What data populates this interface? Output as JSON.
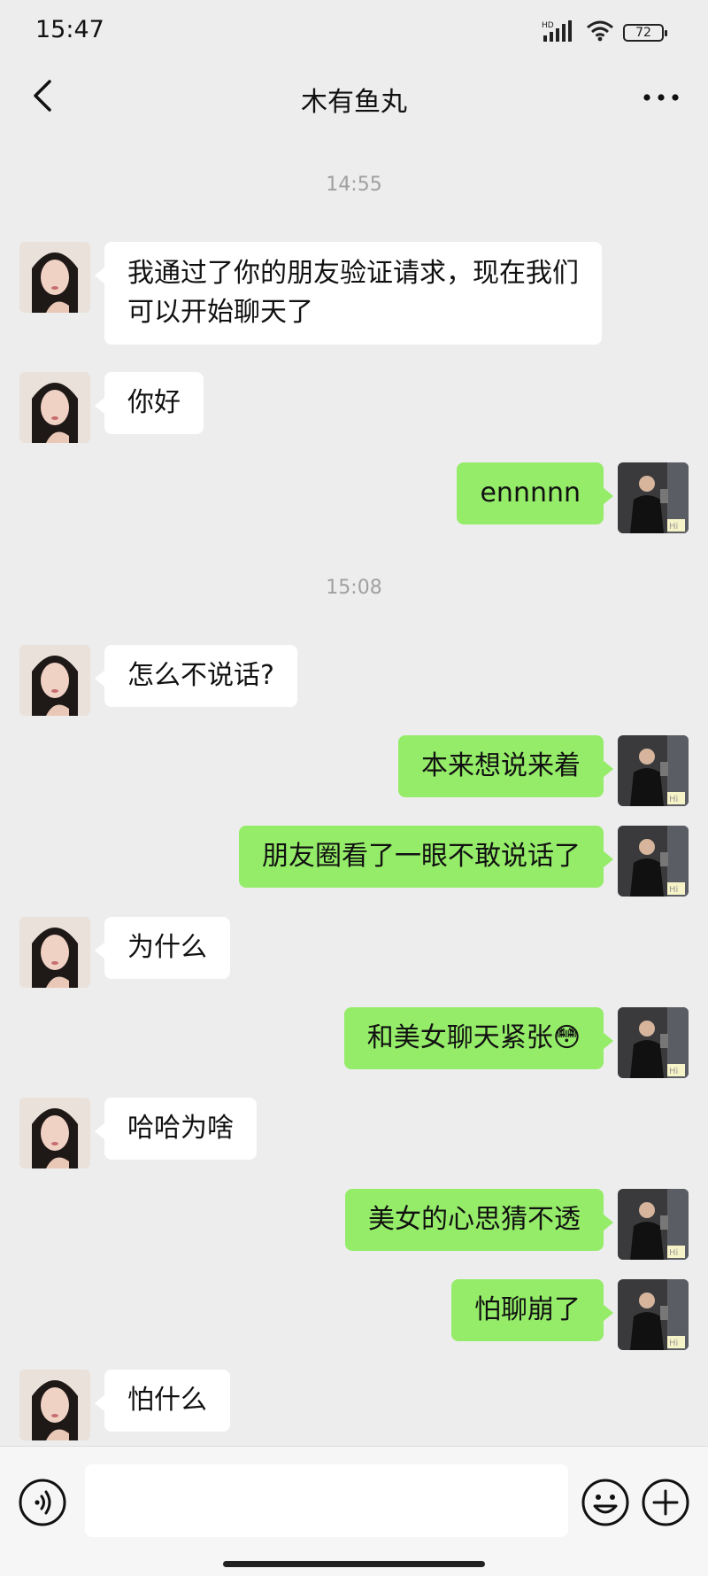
{
  "status_bar": {
    "time": "15:47",
    "network": "HD",
    "battery": "72",
    "icons": [
      "signal-icon",
      "wifi-icon",
      "battery-icon"
    ]
  },
  "header": {
    "title": "木有鱼丸",
    "back_icon": "chevron-left-icon",
    "more_icon": "more-dots-icon"
  },
  "timestamps": [
    "14:55",
    "15:08"
  ],
  "messages": [
    {
      "side": "in",
      "text": "我通过了你的朋友验证请求，现在我们可以开始聊天了"
    },
    {
      "side": "in",
      "text": "你好"
    },
    {
      "side": "out",
      "text": "ennnnn"
    },
    {
      "side": "in",
      "text": "怎么不说话?"
    },
    {
      "side": "out",
      "text": "本来想说来着"
    },
    {
      "side": "out",
      "text": "朋友圈看了一眼不敢说话了"
    },
    {
      "side": "in",
      "text": "为什么"
    },
    {
      "side": "out",
      "text": "和美女聊天紧张😳"
    },
    {
      "side": "in",
      "text": "哈哈为啥"
    },
    {
      "side": "out",
      "text": "美女的心思猜不透"
    },
    {
      "side": "out",
      "text": "怕聊崩了"
    },
    {
      "side": "in",
      "text": "怕什么"
    }
  ],
  "avatar_badge": "Hi",
  "input_bar": {
    "value": "",
    "placeholder": "",
    "icons": [
      "voice-icon",
      "emoji-icon",
      "plus-icon"
    ]
  },
  "colors": {
    "background": "#EDEDED",
    "outgoing_bubble": "#95EC69",
    "incoming_bubble": "#FFFFFF",
    "timestamp": "#A0A0A0"
  }
}
